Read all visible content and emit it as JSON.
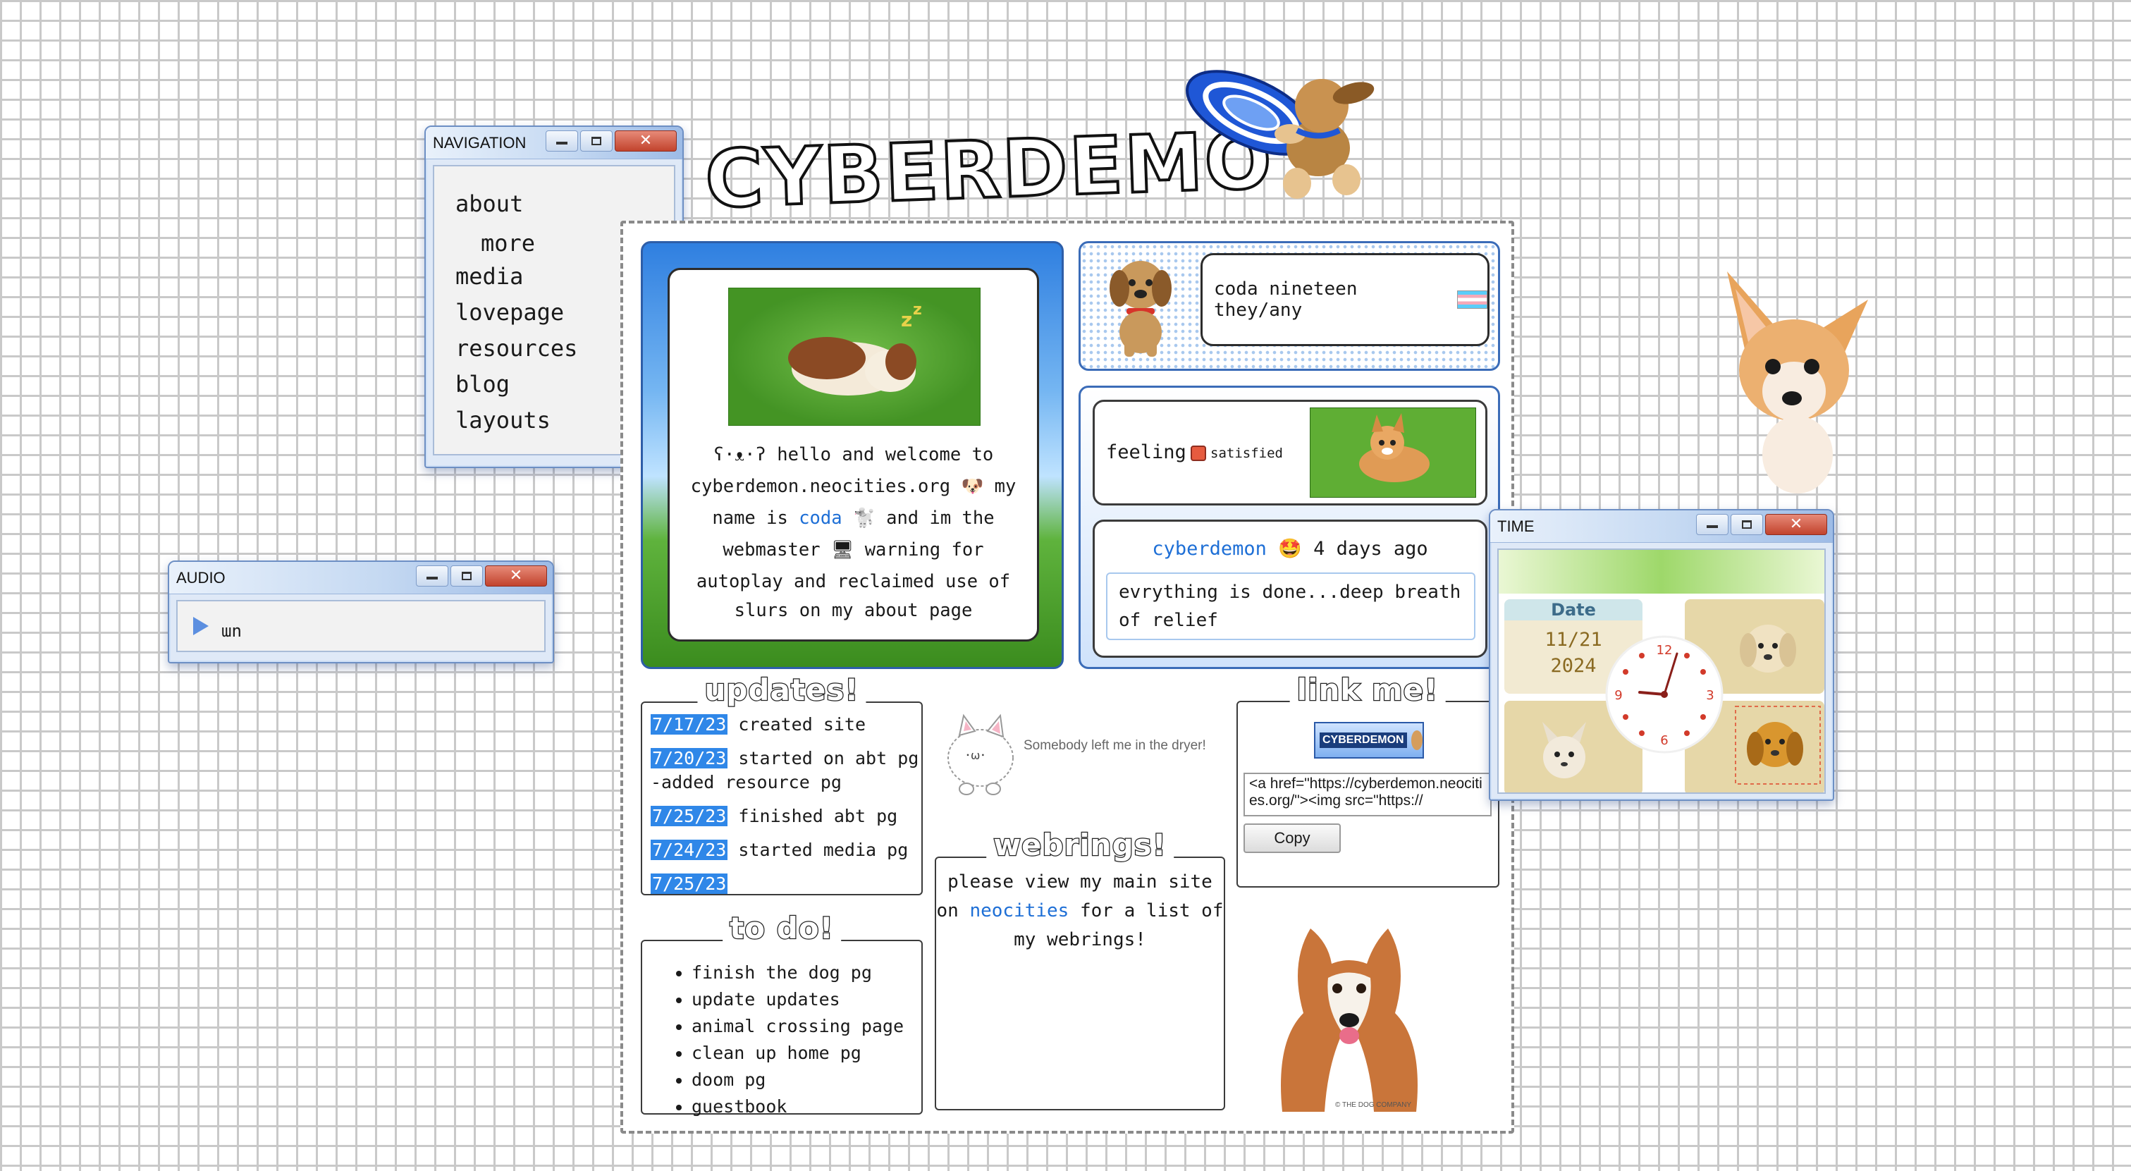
{
  "logo": {
    "text": "CYBERDEMON"
  },
  "nav": {
    "title": "NAVIGATION",
    "items": [
      {
        "label": "about"
      },
      {
        "label": "more"
      },
      {
        "label": "media"
      },
      {
        "label": "lovepage"
      },
      {
        "label": "resources"
      },
      {
        "label": "blog"
      },
      {
        "label": "layouts"
      }
    ]
  },
  "audio": {
    "title": "AUDIO",
    "track": "ɯn"
  },
  "welcome": {
    "t1": "hello and welcome to",
    "site": "cyberdemon.neocities.org",
    "t2": "my",
    "t3": "name is",
    "name": "coda",
    "t4": "and im the",
    "t5": "webmaster",
    "t6": "warning for",
    "t7": "autoplay and reclaimed use of",
    "t8": "slurs on my about page"
  },
  "profile": {
    "text": "coda nineteen they/any"
  },
  "feeling": {
    "label": "feeling:",
    "mood": "satisfied"
  },
  "status": {
    "user": "cyberdemon",
    "time": "4 days ago",
    "message": "evrything is done...deep breath of relief"
  },
  "updates": {
    "title": "updates!",
    "items": [
      {
        "date": "7/17/23",
        "text": "created site"
      },
      {
        "date": "7/20/23",
        "text": "started on abt pg",
        "extra": "-added resource pg"
      },
      {
        "date": "7/25/23",
        "text": "finished abt pg"
      },
      {
        "date": "7/24/23",
        "text": "started media pg"
      },
      {
        "date": "7/25/23",
        "text": ""
      }
    ]
  },
  "dryer": {
    "text": "Somebody left me in the dryer!"
  },
  "linkme": {
    "title": "link me!",
    "banner": "CYBERDEMON",
    "code": "<a href=\"https://cyberdemon.neocities.org/\"><img src=\"https://",
    "copy": "Copy"
  },
  "webrings": {
    "title": "webrings!",
    "t1": "please view my main site",
    "t2": "on",
    "link": "neocities",
    "t3": "for a list of",
    "t4": "my webrings!"
  },
  "todo": {
    "title": "to do!",
    "items": [
      {
        "label": "finish the dog pg"
      },
      {
        "label": "update updates"
      },
      {
        "label": "animal crossing page"
      },
      {
        "label": "clean up home pg"
      },
      {
        "label": "doom pg"
      },
      {
        "label": "guestbook"
      }
    ]
  },
  "dogcredit": "© THE DOG COMPANY",
  "time": {
    "title": "TIME",
    "date_label": "Date",
    "date_md": "11/21",
    "date_year": "2024",
    "clock_numbers": [
      "12",
      "3",
      "6",
      "9"
    ]
  },
  "colors": {
    "accent": "#2f87e8",
    "link": "#1e6fd6",
    "window_border": "#6d8fc4",
    "close": "#c2432d"
  }
}
